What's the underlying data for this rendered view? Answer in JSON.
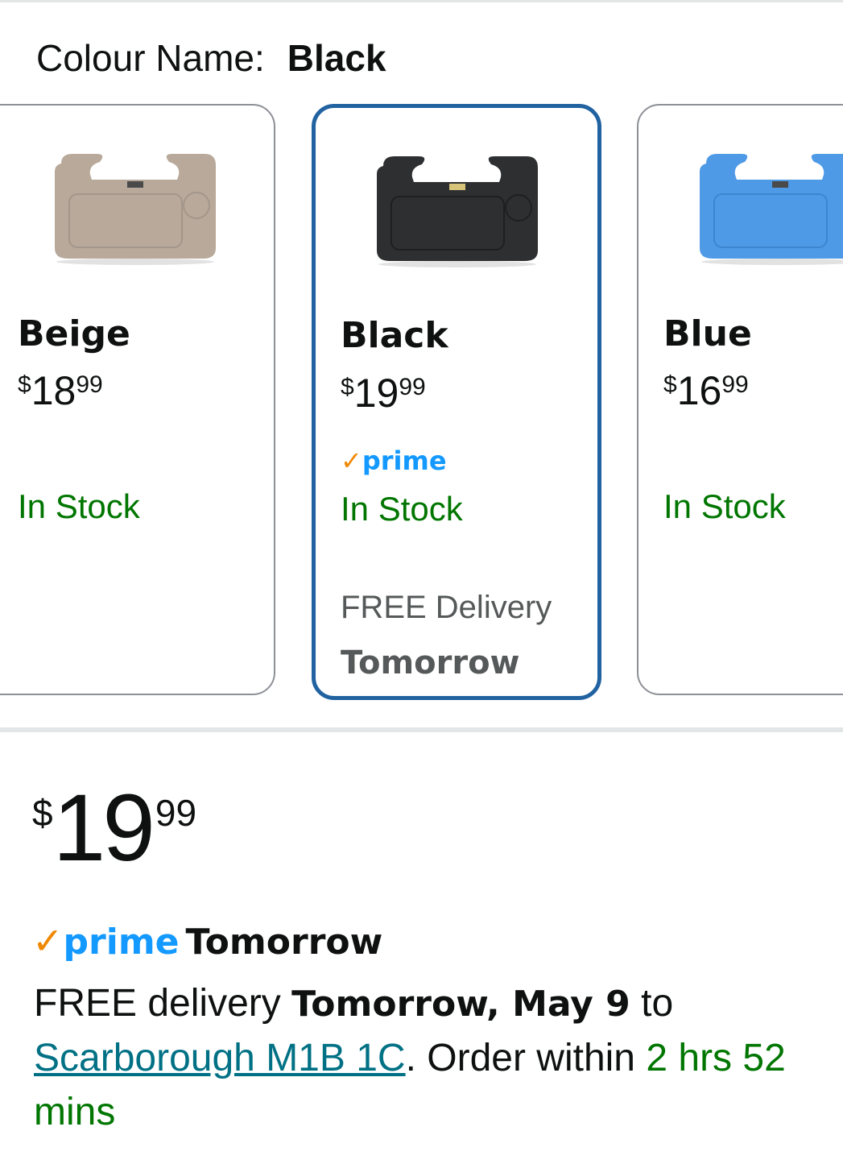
{
  "colour": {
    "label": "Colour Name:",
    "value": "Black"
  },
  "swatches": [
    {
      "name": "Beige",
      "price": {
        "symbol": "$",
        "whole": "18",
        "fraction": "99"
      },
      "availability": "In Stock",
      "tray_color": "#b8a99a",
      "selected": false
    },
    {
      "name": "Black",
      "price": {
        "symbol": "$",
        "whole": "19",
        "fraction": "99"
      },
      "prime": "prime",
      "availability": "In Stock",
      "delivery_line": "FREE Delivery",
      "delivery_date": "Tomorrow",
      "tray_color": "#2e2f31",
      "selected": true
    },
    {
      "name": "Blue",
      "price": {
        "symbol": "$",
        "whole": "16",
        "fraction": "99"
      },
      "availability": "In Stock",
      "tray_color": "#4f9ae6",
      "selected": false
    }
  ],
  "main_price": {
    "symbol": "$",
    "whole": "19",
    "fraction": "99"
  },
  "prime_delivery": {
    "prime": "prime",
    "speed": "Tomorrow"
  },
  "delivery": {
    "prefix": "FREE delivery ",
    "date": "Tomorrow, May 9",
    "to": " to",
    "location": "Scarborough M1B 1C",
    "order_within": ". Order within ",
    "countdown": "2 hrs 52 mins"
  },
  "colors": {
    "accent_selected": "#2162a1",
    "in_stock": "#007600",
    "prime_blue": "#1399ff",
    "prime_check": "#f08804",
    "link": "#007185"
  }
}
